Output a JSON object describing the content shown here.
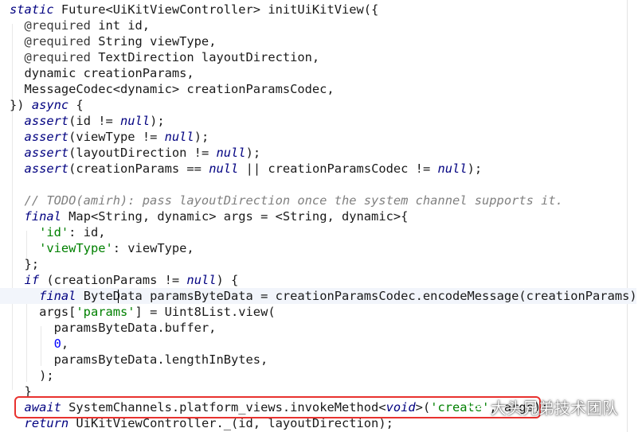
{
  "code": {
    "lines": [
      {
        "segments": [
          {
            "t": "static",
            "c": "kw"
          },
          {
            "t": " Future<UiKitViewController> initUiKitView({",
            "c": ""
          }
        ]
      },
      {
        "segments": [
          {
            "t": "  @required",
            "c": "an"
          },
          {
            "t": " int id,",
            "c": ""
          }
        ]
      },
      {
        "segments": [
          {
            "t": "  @required",
            "c": "an"
          },
          {
            "t": " String viewType,",
            "c": ""
          }
        ]
      },
      {
        "segments": [
          {
            "t": "  @required",
            "c": "an"
          },
          {
            "t": " TextDirection layoutDirection,",
            "c": ""
          }
        ]
      },
      {
        "segments": [
          {
            "t": "  dynamic creationParams,",
            "c": ""
          }
        ]
      },
      {
        "segments": [
          {
            "t": "  MessageCodec<dynamic> creationParamsCodec,",
            "c": ""
          }
        ]
      },
      {
        "segments": [
          {
            "t": "}) ",
            "c": ""
          },
          {
            "t": "async",
            "c": "kw"
          },
          {
            "t": " {",
            "c": ""
          }
        ]
      },
      {
        "segments": [
          {
            "t": "  ",
            "c": ""
          },
          {
            "t": "assert",
            "c": "kw"
          },
          {
            "t": "(id != ",
            "c": ""
          },
          {
            "t": "null",
            "c": "kw"
          },
          {
            "t": ");",
            "c": ""
          }
        ]
      },
      {
        "segments": [
          {
            "t": "  ",
            "c": ""
          },
          {
            "t": "assert",
            "c": "kw"
          },
          {
            "t": "(viewType != ",
            "c": ""
          },
          {
            "t": "null",
            "c": "kw"
          },
          {
            "t": ");",
            "c": ""
          }
        ]
      },
      {
        "segments": [
          {
            "t": "  ",
            "c": ""
          },
          {
            "t": "assert",
            "c": "kw"
          },
          {
            "t": "(layoutDirection != ",
            "c": ""
          },
          {
            "t": "null",
            "c": "kw"
          },
          {
            "t": ");",
            "c": ""
          }
        ]
      },
      {
        "segments": [
          {
            "t": "  ",
            "c": ""
          },
          {
            "t": "assert",
            "c": "kw"
          },
          {
            "t": "(creationParams == ",
            "c": ""
          },
          {
            "t": "null",
            "c": "kw"
          },
          {
            "t": " || creationParamsCodec != ",
            "c": ""
          },
          {
            "t": "null",
            "c": "kw"
          },
          {
            "t": ");",
            "c": ""
          }
        ]
      },
      {
        "segments": [
          {
            "t": "",
            "c": ""
          }
        ]
      },
      {
        "segments": [
          {
            "t": "  // TODO(amirh): pass layoutDirection once the system channel supports it.",
            "c": "cm"
          }
        ]
      },
      {
        "segments": [
          {
            "t": "  ",
            "c": ""
          },
          {
            "t": "final",
            "c": "kw"
          },
          {
            "t": " Map<String, dynamic> args = <String, dynamic>{",
            "c": ""
          }
        ]
      },
      {
        "segments": [
          {
            "t": "    ",
            "c": ""
          },
          {
            "t": "'id'",
            "c": "str"
          },
          {
            "t": ": id,",
            "c": ""
          }
        ]
      },
      {
        "segments": [
          {
            "t": "    ",
            "c": ""
          },
          {
            "t": "'viewType'",
            "c": "str"
          },
          {
            "t": ": viewType,",
            "c": ""
          }
        ]
      },
      {
        "segments": [
          {
            "t": "  };",
            "c": ""
          }
        ]
      },
      {
        "segments": [
          {
            "t": "  ",
            "c": ""
          },
          {
            "t": "if",
            "c": "kw"
          },
          {
            "t": " (creationParams != ",
            "c": ""
          },
          {
            "t": "null",
            "c": "kw"
          },
          {
            "t": ") {",
            "c": ""
          }
        ]
      },
      {
        "segments": [
          {
            "t": "    ",
            "c": ""
          },
          {
            "t": "final",
            "c": "kw"
          },
          {
            "t": " ByteData paramsByteData = creationParamsCodec.encodeMessage(creationParams);",
            "c": ""
          }
        ]
      },
      {
        "segments": [
          {
            "t": "    args[",
            "c": ""
          },
          {
            "t": "'params'",
            "c": "str"
          },
          {
            "t": "] = Uint8List.view(",
            "c": ""
          }
        ]
      },
      {
        "segments": [
          {
            "t": "      paramsByteData.buffer,",
            "c": ""
          }
        ]
      },
      {
        "segments": [
          {
            "t": "      ",
            "c": ""
          },
          {
            "t": "0",
            "c": "num"
          },
          {
            "t": ",",
            "c": ""
          }
        ]
      },
      {
        "segments": [
          {
            "t": "      paramsByteData.lengthInBytes,",
            "c": ""
          }
        ]
      },
      {
        "segments": [
          {
            "t": "    );",
            "c": ""
          }
        ]
      },
      {
        "segments": [
          {
            "t": "  }",
            "c": ""
          }
        ]
      },
      {
        "segments": [
          {
            "t": "  ",
            "c": ""
          },
          {
            "t": "await",
            "c": "kw"
          },
          {
            "t": " SystemChannels.platform_views.invokeMethod<",
            "c": ""
          },
          {
            "t": "void",
            "c": "kw"
          },
          {
            "t": ">(",
            "c": ""
          },
          {
            "t": "'create'",
            "c": "str"
          },
          {
            "t": ", args);",
            "c": ""
          }
        ]
      },
      {
        "segments": [
          {
            "t": "  ",
            "c": ""
          },
          {
            "t": "return",
            "c": "kw"
          },
          {
            "t": " UiKitViewController._(id, layoutDirection);",
            "c": ""
          }
        ]
      }
    ],
    "highlighted_line": 18,
    "caret_line": 18
  },
  "watermark": {
    "text": "大头兄弟技术团队",
    "icon": "wechat-icon"
  },
  "colors": {
    "keyword": "#000080",
    "string": "#008000",
    "number": "#0000ff",
    "comment": "#808080",
    "highlight_box": "#e8322f"
  }
}
